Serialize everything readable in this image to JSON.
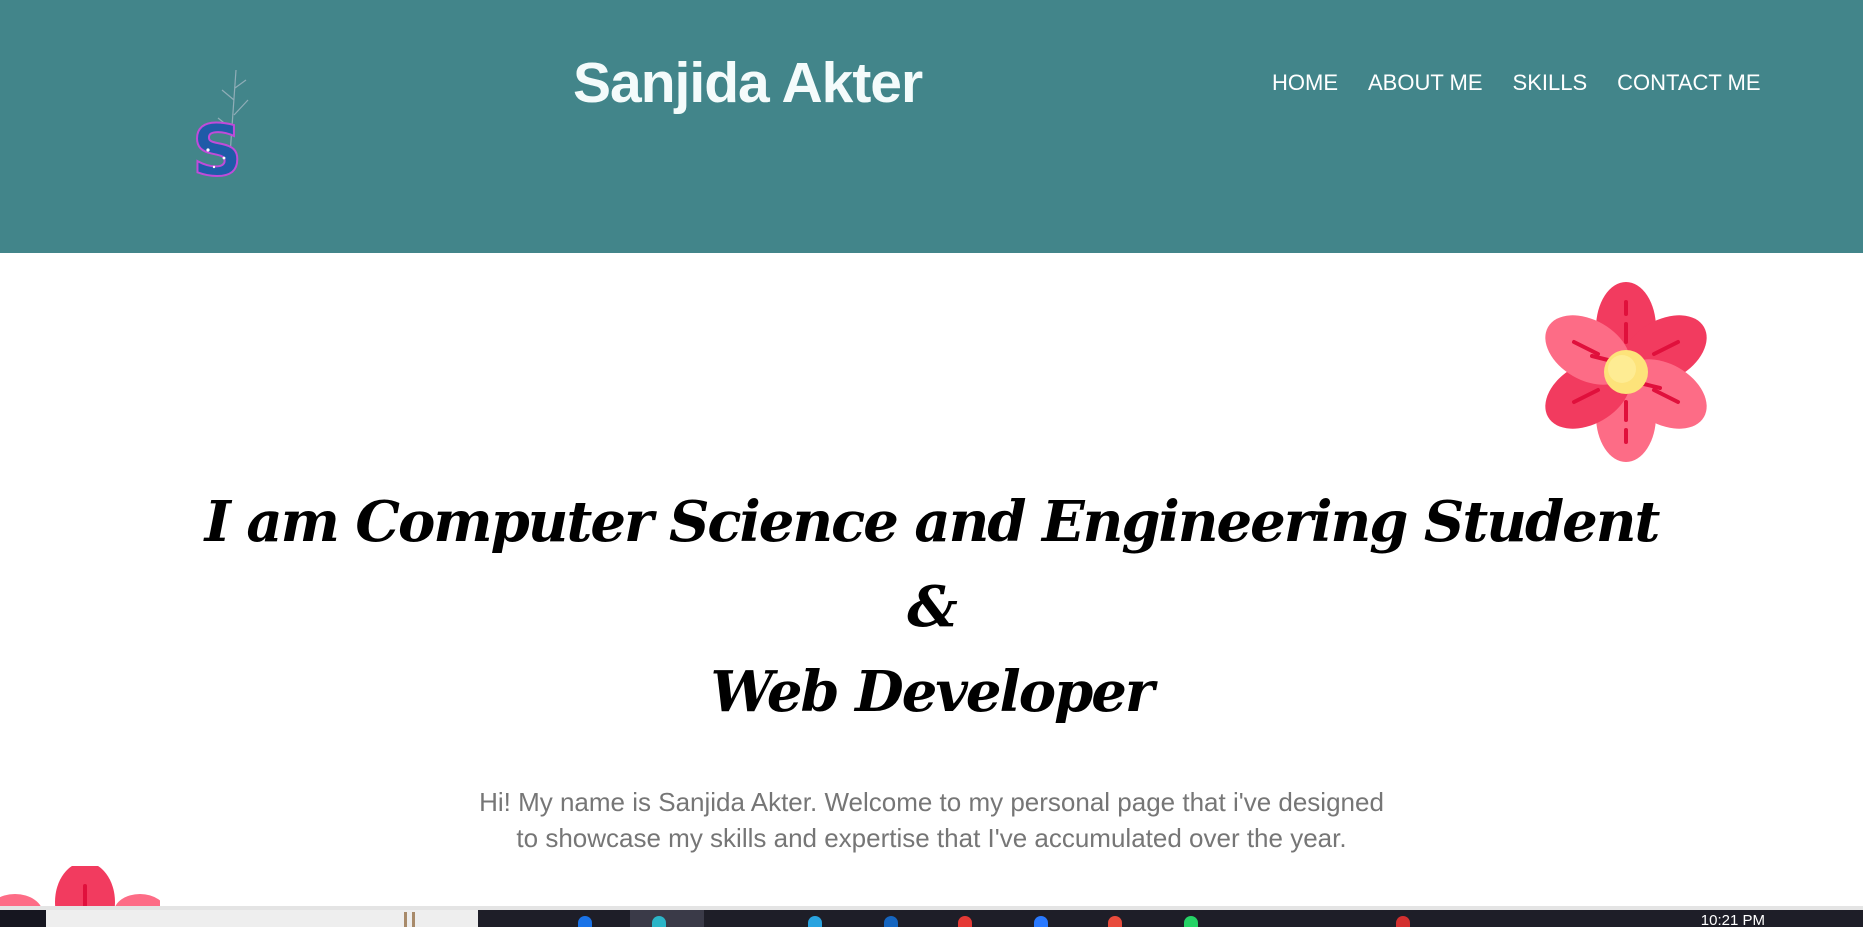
{
  "header": {
    "title": "Sanjida Akter",
    "logo_letter": "S",
    "bg_color": "#42858a"
  },
  "nav": {
    "items": [
      {
        "label": "HOME"
      },
      {
        "label": "ABOUT ME"
      },
      {
        "label": "SKILLS"
      },
      {
        "label": "CONTACT ME"
      }
    ]
  },
  "hero": {
    "line1": "I am Computer Science and Engineering Student",
    "line2": "&",
    "line3": "Web Developer"
  },
  "intro": {
    "line1": "Hi! My name is Sanjida Akter. Welcome to my personal page that i've designed",
    "line2": "to showcase my skills and expertise that I've accumulated over the year."
  },
  "taskbar": {
    "clock": "10:21 PM"
  },
  "colors": {
    "accent": "#42858a",
    "petal_light": "#fd6c86",
    "petal_dark": "#f23b5f",
    "flower_center": "#fde37a"
  }
}
